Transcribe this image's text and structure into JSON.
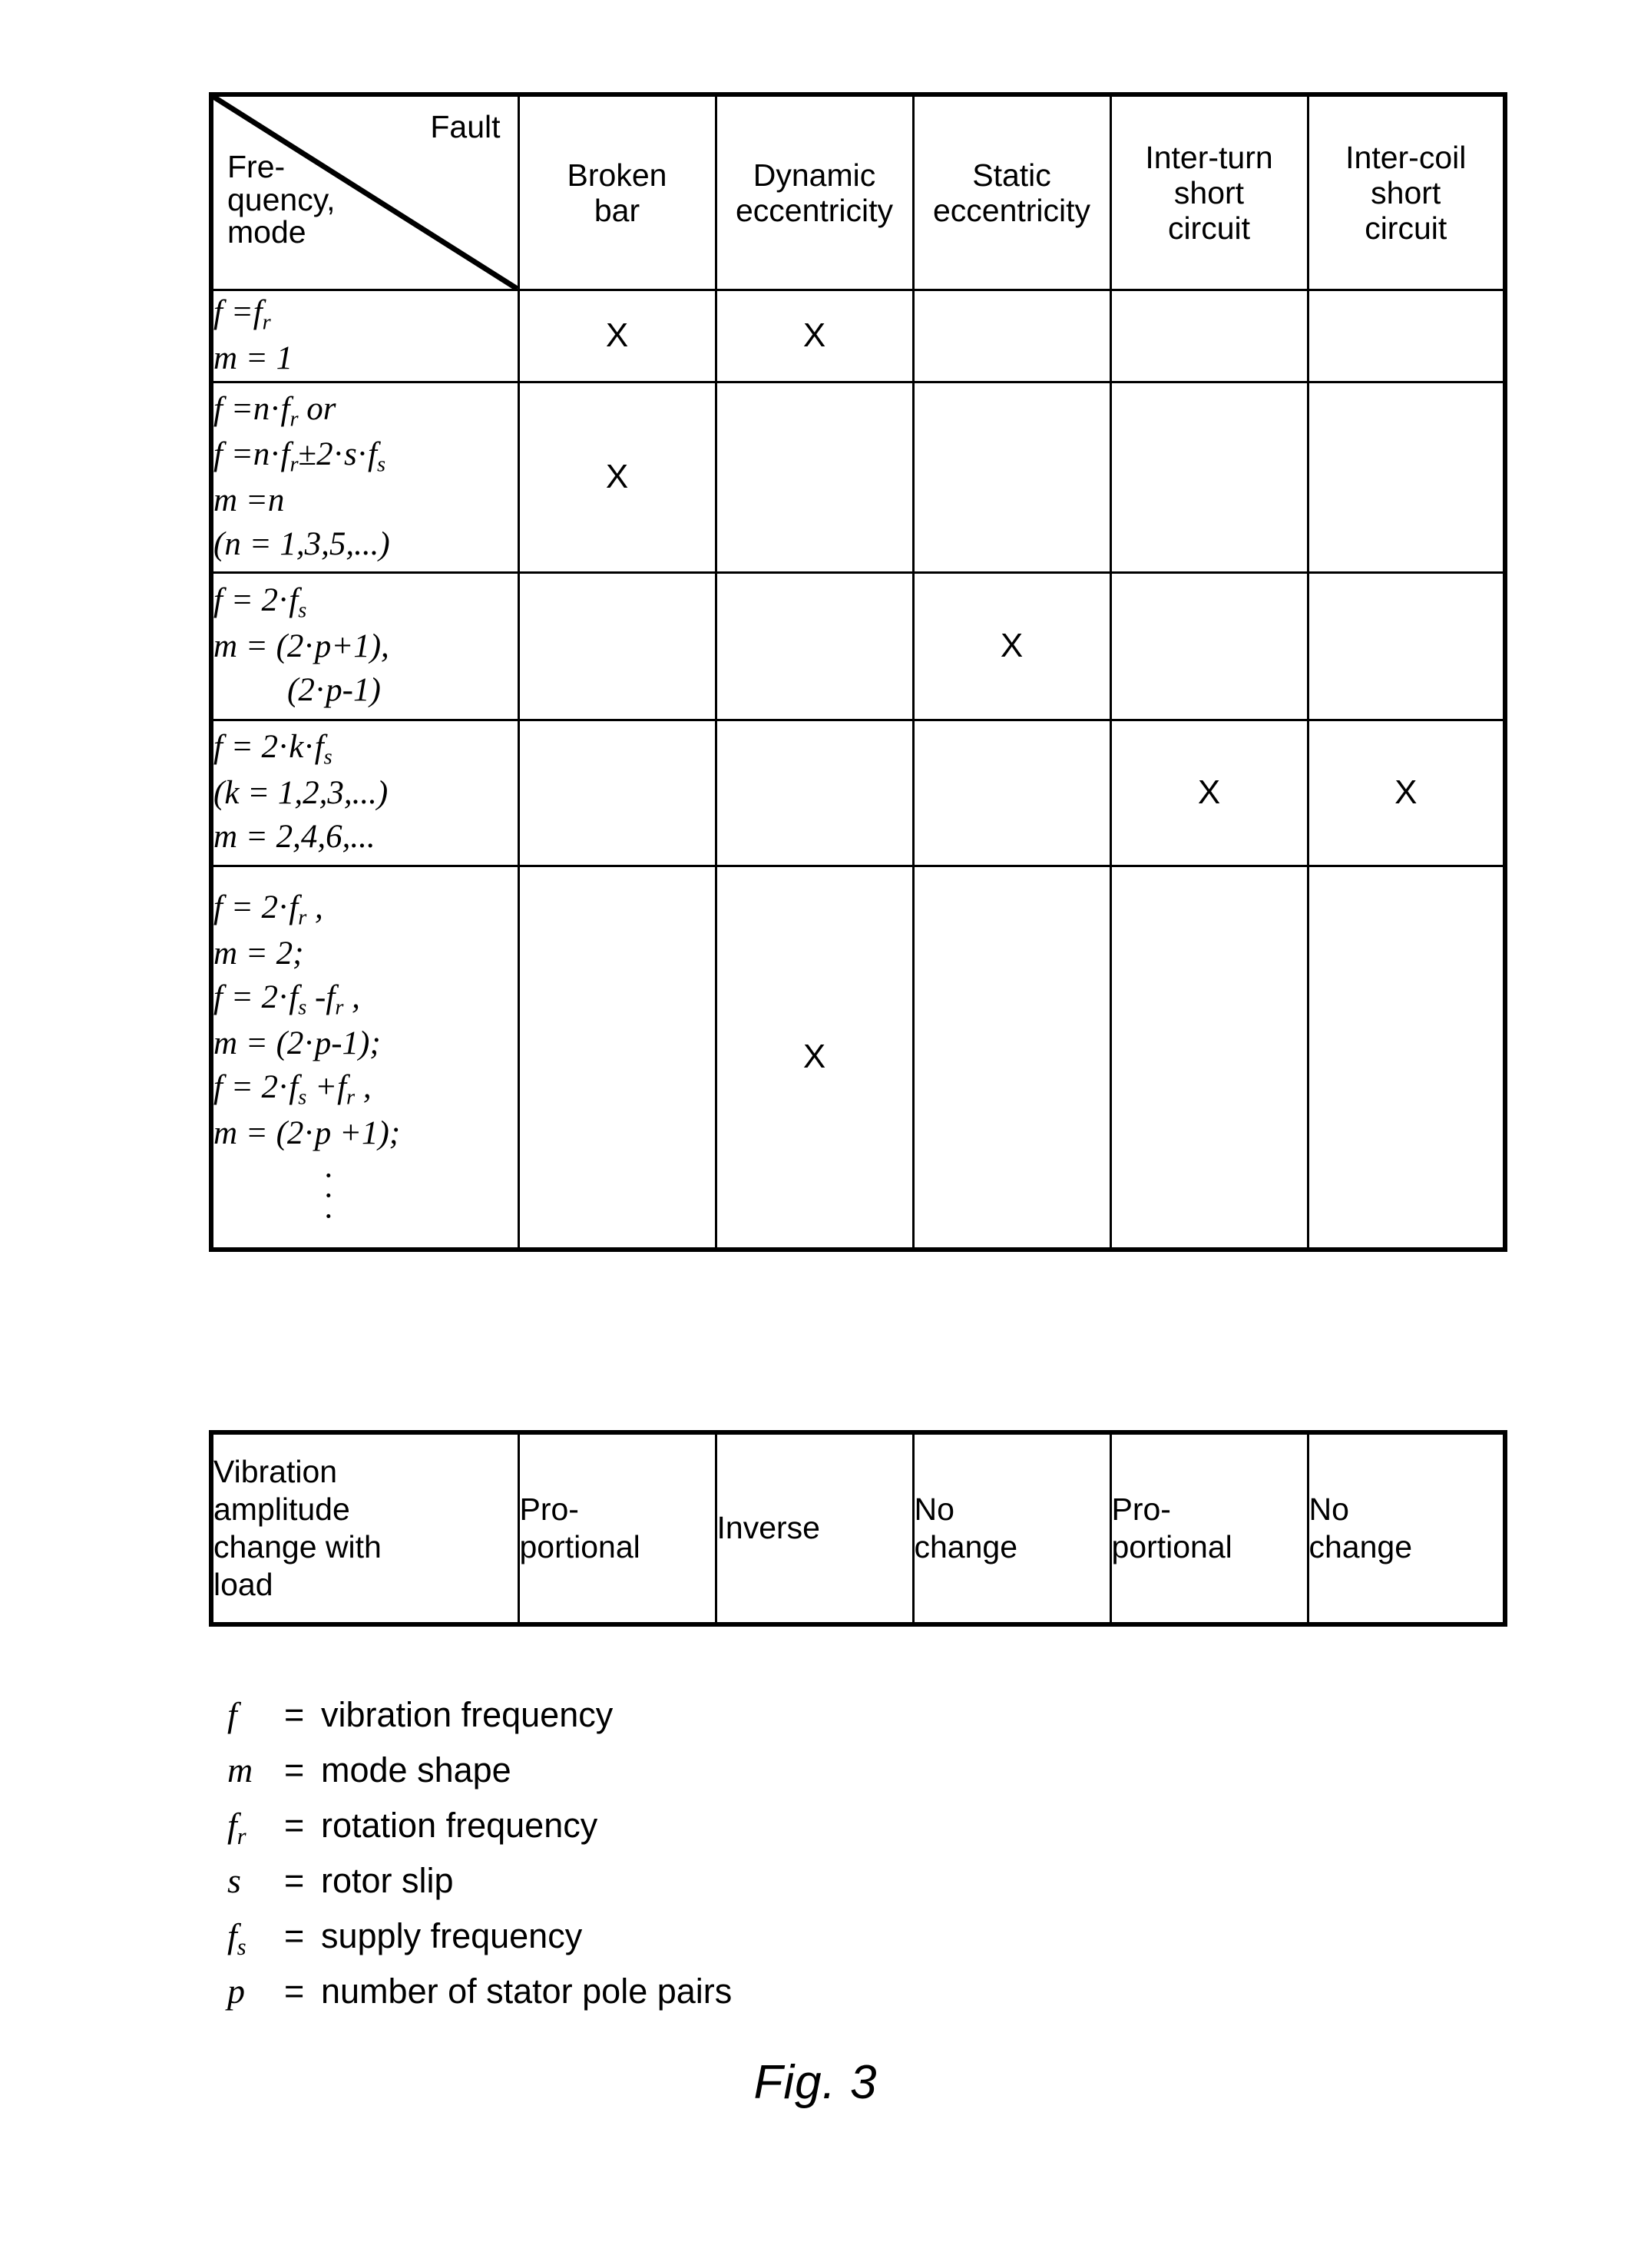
{
  "figure": {
    "caption": "Fig. 3"
  },
  "matrix_table": {
    "corner": {
      "column_axis_label": "Fault",
      "row_axis_label": "Fre-\nquency,\nmode",
      "row_axis_line1": "Fre-",
      "row_axis_line2": "quency,",
      "row_axis_line3": "mode"
    },
    "fault_columns": [
      {
        "line1": "Broken",
        "line2": "bar",
        "line3": ""
      },
      {
        "line1": "Dynamic",
        "line2": "eccentricity",
        "line3": ""
      },
      {
        "line1": "Static",
        "line2": "eccentricity",
        "line3": ""
      },
      {
        "line1": "Inter-turn",
        "line2": "short",
        "line3": "circuit"
      },
      {
        "line1": "Inter-coil",
        "line2": "short",
        "line3": "circuit"
      }
    ],
    "mark_symbol": "X",
    "rows": [
      {
        "formula_lines": [
          {
            "text": "f = f",
            "sub": "r",
            "tail": "",
            "indent": false
          },
          {
            "text": "m = 1",
            "sub": "",
            "tail": "",
            "indent": false
          }
        ],
        "marks": [
          "X",
          "X",
          "",
          "",
          ""
        ]
      },
      {
        "formula_lines": [
          {
            "text": "f = n·f",
            "sub": "r",
            "tail": " or",
            "indent": false
          },
          {
            "text": "f = n·f",
            "sub": "r",
            "tail": "±2·s·f",
            "tail_sub": "s",
            "indent": false
          },
          {
            "text": "m = n",
            "sub": "",
            "tail": "",
            "indent": false
          },
          {
            "text": "(n = 1,3,5,...)",
            "sub": "",
            "tail": "",
            "indent": false
          }
        ],
        "marks": [
          "X",
          "",
          "",
          "",
          ""
        ]
      },
      {
        "formula_lines": [
          {
            "text": "f = 2·f",
            "sub": "s",
            "tail": "",
            "indent": false
          },
          {
            "text": "m = (2·p+1),",
            "sub": "",
            "tail": "",
            "indent": false
          },
          {
            "text": "(2·p-1)",
            "sub": "",
            "tail": "",
            "indent": true
          }
        ],
        "marks": [
          "",
          "",
          "X",
          "",
          ""
        ]
      },
      {
        "formula_lines": [
          {
            "text": "f = 2·k·f",
            "sub": "s",
            "tail": "",
            "indent": false
          },
          {
            "text": "(k = 1,2,3,...)",
            "sub": "",
            "tail": "",
            "indent": false
          },
          {
            "text": "m = 2,4,6,...",
            "sub": "",
            "tail": "",
            "indent": false
          }
        ],
        "marks": [
          "",
          "",
          "",
          "X",
          "X"
        ]
      },
      {
        "formula_lines": [
          {
            "text": "f = 2·f",
            "sub": "r",
            "tail": ",",
            "indent": false
          },
          {
            "text": "m = 2;",
            "sub": "",
            "tail": "",
            "indent": false
          },
          {
            "text": "f = 2·f",
            "sub": "s",
            "tail": "-f",
            "tail_sub": "r",
            "tail2": " ,",
            "indent": false
          },
          {
            "text": "m = (2·p-1);",
            "sub": "",
            "tail": "",
            "indent": false
          },
          {
            "text": "f = 2·f",
            "sub": "s",
            "tail": "+f",
            "tail_sub": "r",
            "tail2": " ,",
            "indent": false
          },
          {
            "text": "m = (2·p +1);",
            "sub": "",
            "tail": "",
            "indent": false
          }
        ],
        "ellipsis": "vertical-dots",
        "marks": [
          "",
          "X",
          "",
          "",
          ""
        ]
      }
    ]
  },
  "summary_table": {
    "label": "Vibration amplitude change with load",
    "label_lines": [
      "Vibration",
      "amplitude",
      "change with",
      "load"
    ],
    "values": [
      {
        "line1": "Pro-",
        "line2": "portional"
      },
      {
        "line1": "Inverse",
        "line2": ""
      },
      {
        "line1": "No",
        "line2": "change"
      },
      {
        "line1": "Pro-",
        "line2": "portional"
      },
      {
        "line1": "No",
        "line2": "change"
      }
    ]
  },
  "legend": {
    "entries": [
      {
        "symbol": "f",
        "sub": "",
        "equals": "=",
        "definition": "vibration frequency"
      },
      {
        "symbol": "m",
        "sub": "",
        "equals": "=",
        "definition": "mode shape"
      },
      {
        "symbol": "f",
        "sub": "r",
        "equals": "=",
        "definition": "rotation frequency"
      },
      {
        "symbol": "s",
        "sub": "",
        "equals": "=",
        "definition": "rotor slip"
      },
      {
        "symbol": "f",
        "sub": "s",
        "equals": "=",
        "definition": "supply frequency"
      },
      {
        "symbol": "p",
        "sub": "",
        "equals": "=",
        "definition": "number of stator pole pairs"
      }
    ]
  },
  "colors": {
    "ink": "#000000",
    "paper": "#ffffff"
  }
}
